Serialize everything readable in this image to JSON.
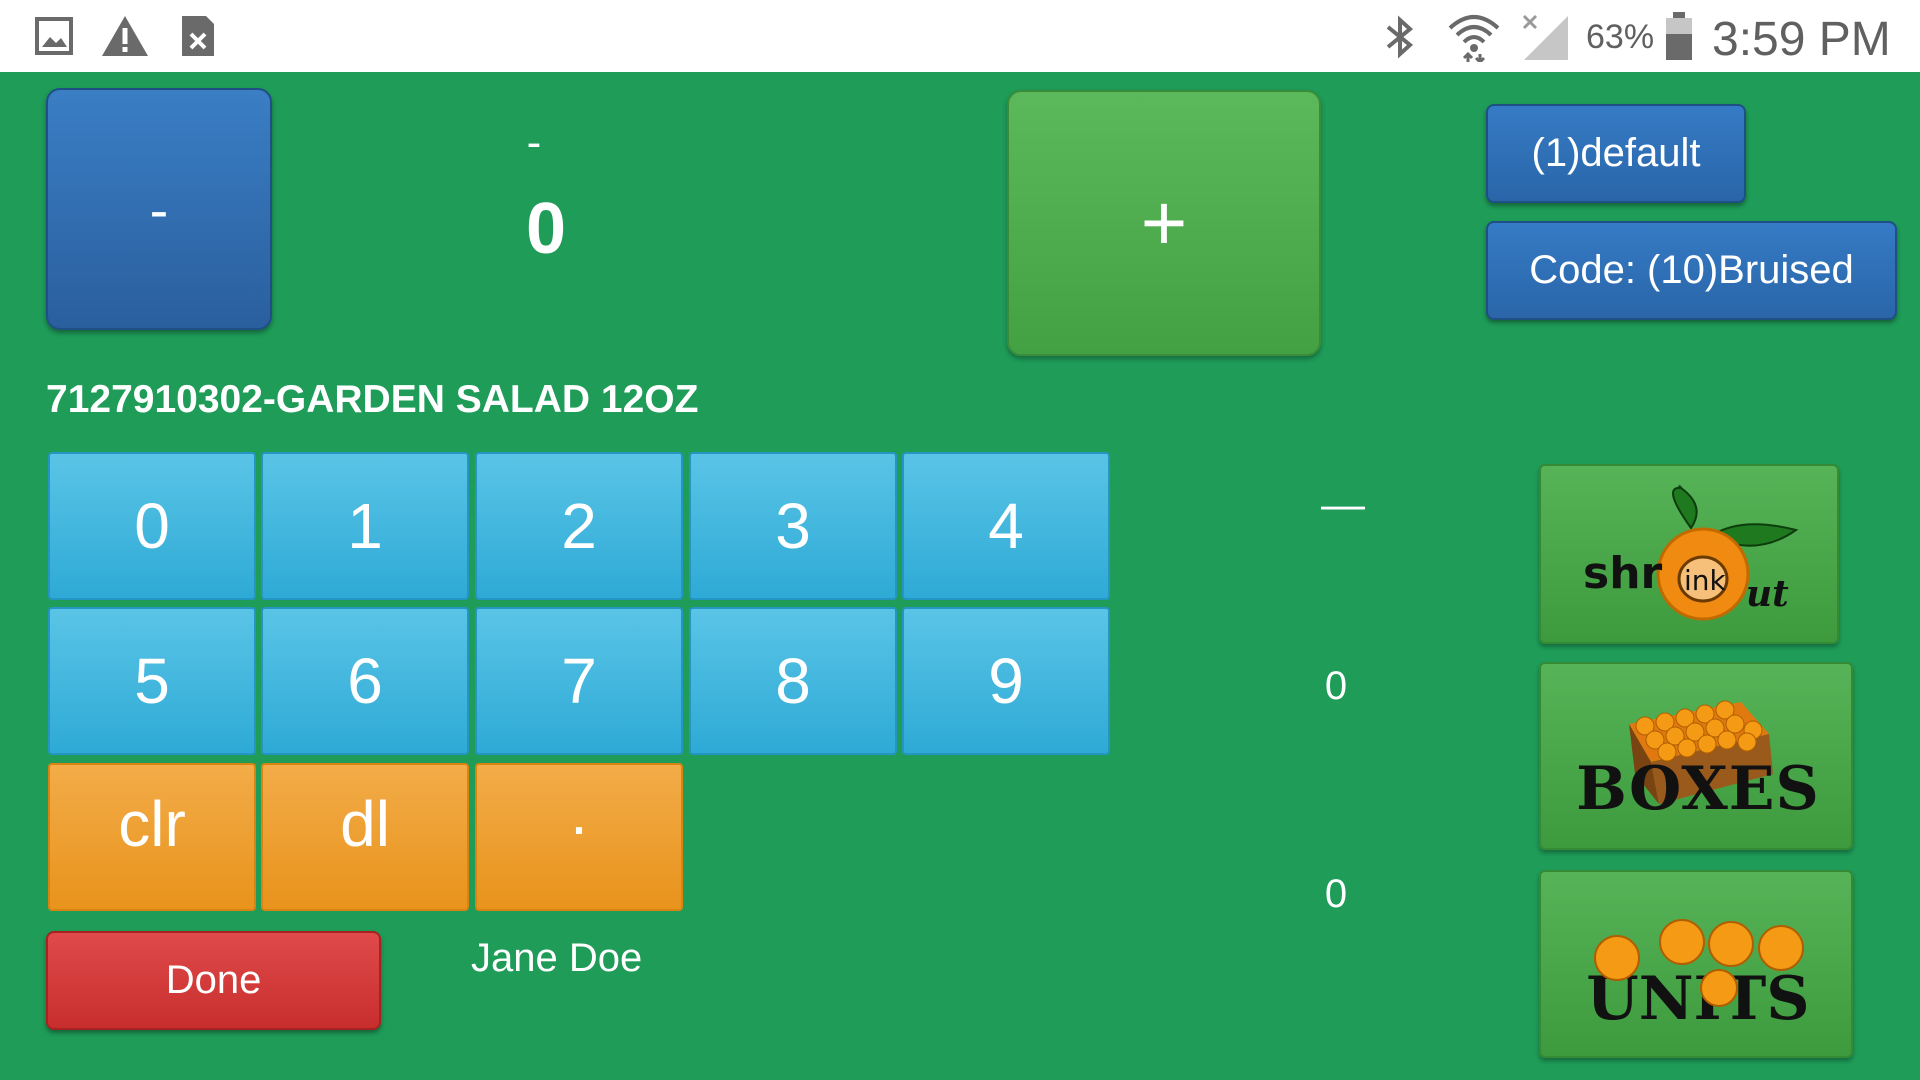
{
  "status_bar": {
    "battery": "63%",
    "time": "3:59 PM",
    "icons": [
      "gallery-icon",
      "warning-icon",
      "file-close-icon",
      "bluetooth-icon",
      "wifi-icon",
      "signal-icon",
      "battery-icon"
    ]
  },
  "counter": {
    "minus_label": "-",
    "plus_label": "+",
    "sign": "-",
    "value": "0"
  },
  "options": {
    "default_label": "(1)default",
    "code_label": "Code: (10)Bruised"
  },
  "product": {
    "title": "7127910302-GARDEN SALAD 12OZ"
  },
  "keypad": {
    "digits": [
      "0",
      "1",
      "2",
      "3",
      "4",
      "5",
      "6",
      "7",
      "8",
      "9"
    ],
    "clear": "clr",
    "delete": "dl",
    "decimal": "."
  },
  "footer": {
    "done_label": "Done",
    "user": "Jane Doe"
  },
  "side_values": {
    "shrink": "—",
    "boxes": "0",
    "units": "0"
  },
  "side_buttons": {
    "shrink_logo": "shrink out",
    "boxes_label": "BOXES",
    "units_label": "UNITS"
  },
  "colors": {
    "background": "#1e9c58",
    "blue": "#2f6fb3",
    "green": "#4caf50",
    "keypad_blue": "#3db5df",
    "keypad_orange": "#eea033",
    "done_red": "#d43c3c"
  }
}
